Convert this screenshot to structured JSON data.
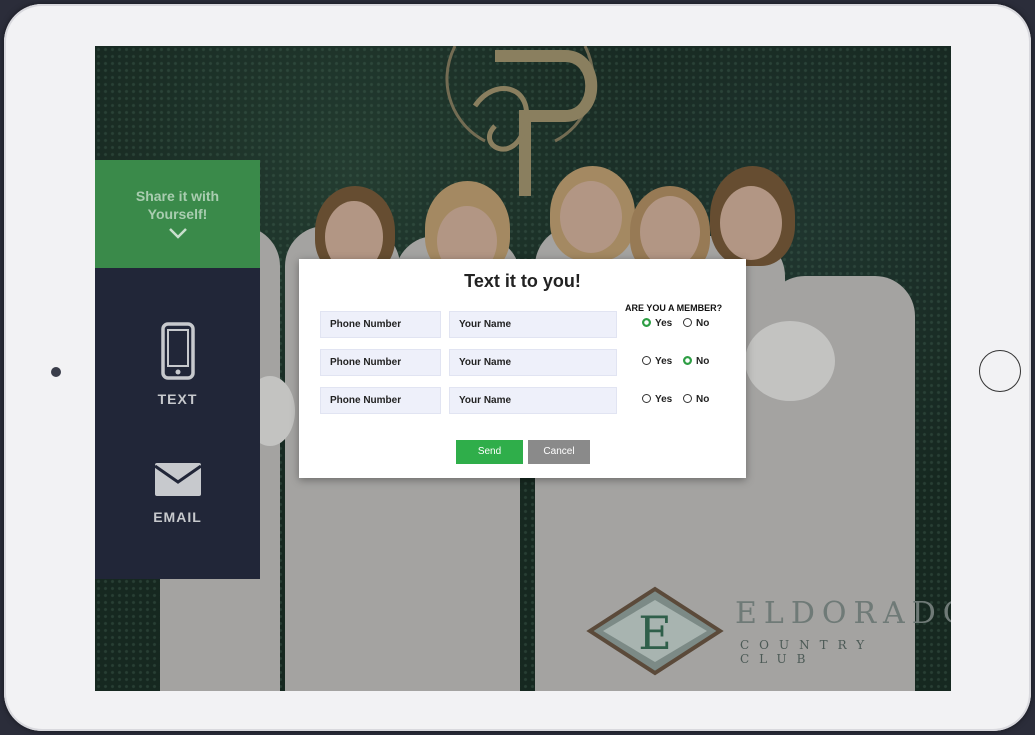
{
  "sidebar": {
    "share_line1": "Share it with",
    "share_line2": "Yourself!",
    "text_label": "TEXT",
    "email_label": "EMAIL"
  },
  "modal": {
    "title": "Text it to you!",
    "member_question": "ARE YOU A MEMBER?",
    "rows": [
      {
        "phone_placeholder": "Phone Number",
        "name_placeholder": "Your Name",
        "yes": "Yes",
        "no": "No",
        "selected": "yes"
      },
      {
        "phone_placeholder": "Phone Number",
        "name_placeholder": "Your Name",
        "yes": "Yes",
        "no": "No",
        "selected": "no"
      },
      {
        "phone_placeholder": "Phone Number",
        "name_placeholder": "Your Name",
        "yes": "Yes",
        "no": "No",
        "selected": ""
      }
    ],
    "send_label": "Send",
    "cancel_label": "Cancel"
  },
  "branding": {
    "logo_letter": "E",
    "logo_word": "ELDORADO",
    "logo_sub": "COUNTRY CLUB"
  },
  "colors": {
    "accent_green": "#2fae4a",
    "sidebar_green": "#3a8a4a",
    "sidebar_navy": "#212638",
    "cancel_gray": "#8a8a8a"
  }
}
